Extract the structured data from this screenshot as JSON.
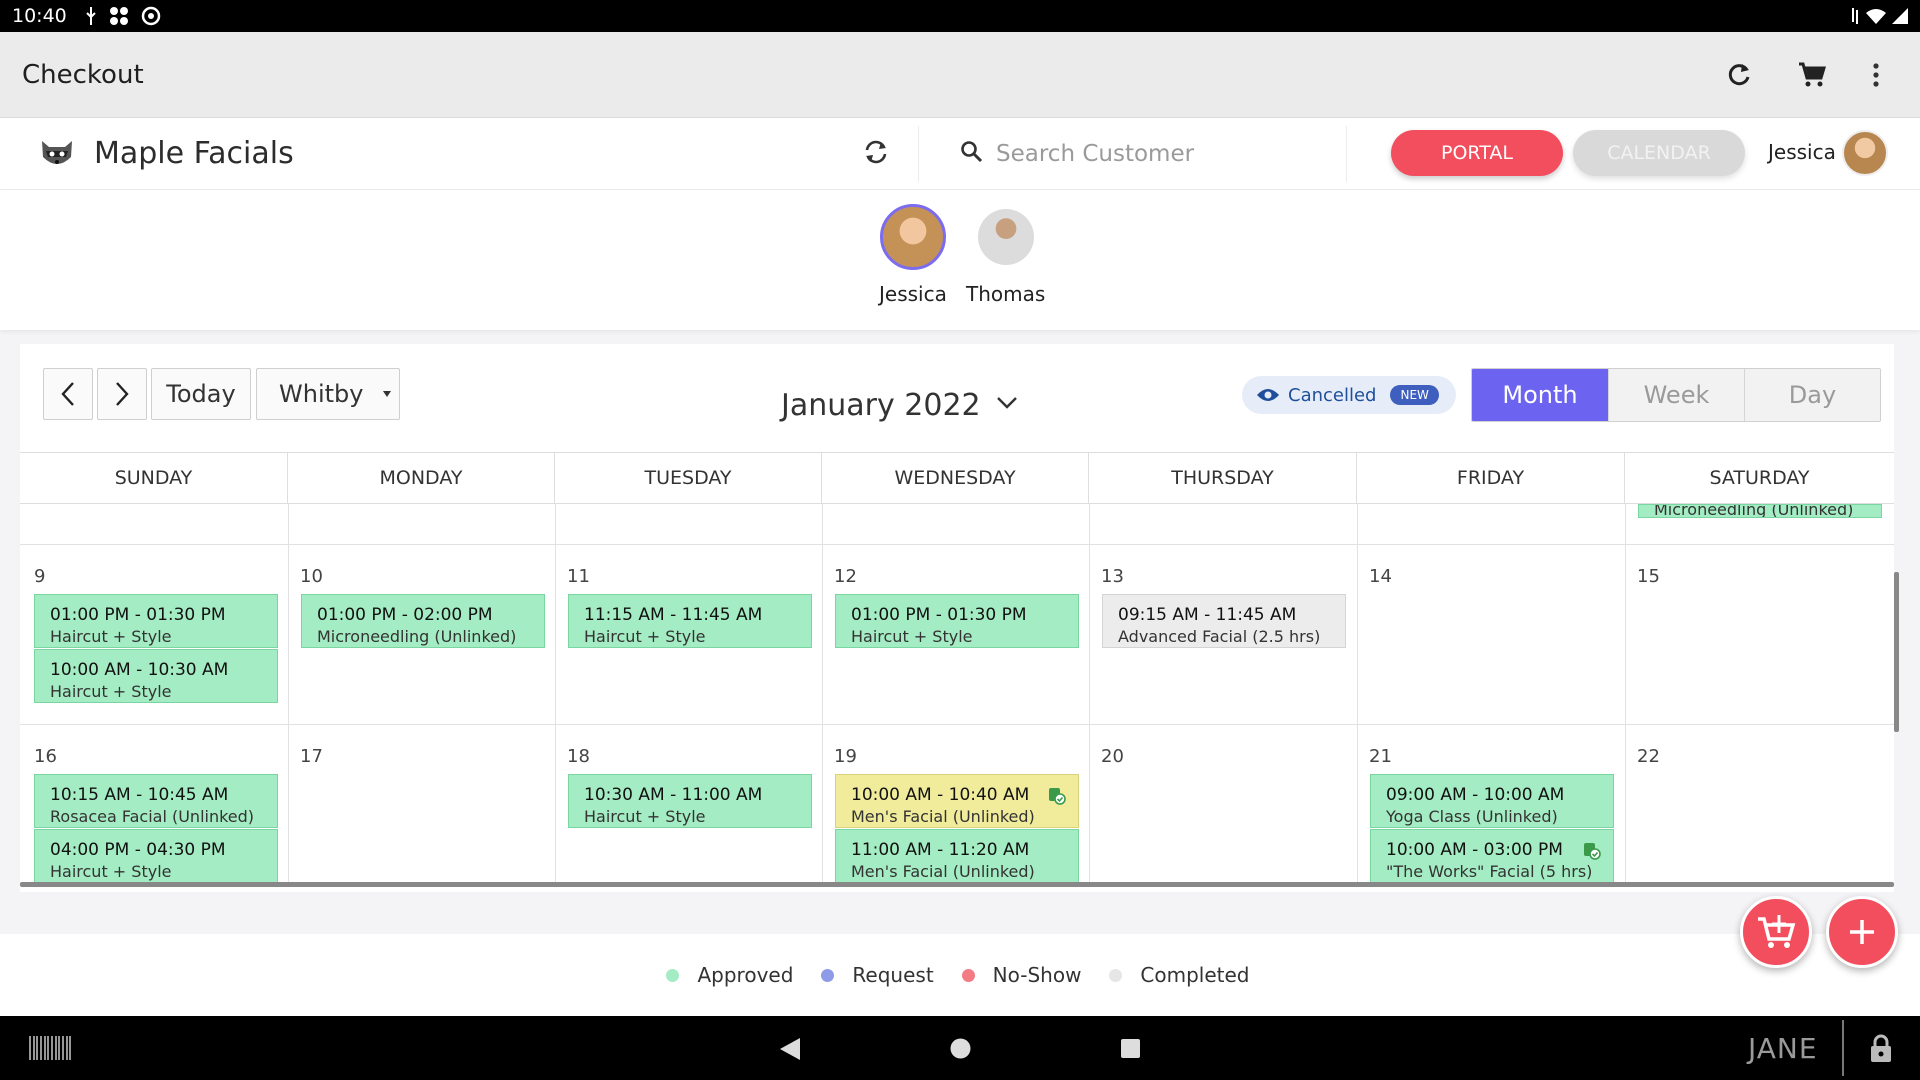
{
  "status_bar": {
    "time": "10:40"
  },
  "app_bar": {
    "title": "Checkout",
    "icons": [
      "refresh-icon",
      "cart-icon",
      "more-vert-icon"
    ]
  },
  "header": {
    "brand": "Maple Facials",
    "search_placeholder": "Search Customer",
    "portal_label": "PORTAL",
    "calendar_label": "CALENDAR",
    "user_name": "Jessica",
    "colors": {
      "portal": "#f24e5e",
      "calendar": "#d9d9d9"
    }
  },
  "staff": [
    {
      "name": "Jessica",
      "selected": true
    },
    {
      "name": "Thomas",
      "selected": false
    }
  ],
  "toolbar": {
    "today_label": "Today",
    "location": "Whitby",
    "month_label": "January 2022",
    "cancelled_label": "Cancelled",
    "new_badge": "NEW",
    "views": [
      "Month",
      "Week",
      "Day"
    ],
    "active_view": "Month"
  },
  "weekdays": [
    "SUNDAY",
    "MONDAY",
    "TUESDAY",
    "WEDNESDAY",
    "THURSDAY",
    "FRIDAY",
    "SATURDAY"
  ],
  "partial_event": {
    "service": "Microneedling (Unlinked)"
  },
  "weeks": [
    {
      "days": [
        {
          "num": "9",
          "events": [
            {
              "time": "01:00 PM - 01:30 PM",
              "service": "Haircut + Style",
              "status": "approved"
            },
            {
              "time": "10:00 AM - 10:30 AM",
              "service": "Haircut + Style",
              "status": "approved"
            }
          ]
        },
        {
          "num": "10",
          "events": [
            {
              "time": "01:00 PM - 02:00 PM",
              "service": "Microneedling (Unlinked)",
              "status": "approved"
            }
          ]
        },
        {
          "num": "11",
          "events": [
            {
              "time": "11:15 AM - 11:45 AM",
              "service": "Haircut + Style",
              "status": "approved"
            }
          ]
        },
        {
          "num": "12",
          "events": [
            {
              "time": "01:00 PM - 01:30 PM",
              "service": "Haircut + Style",
              "status": "approved"
            }
          ]
        },
        {
          "num": "13",
          "events": [
            {
              "time": "09:15 AM - 11:45 AM",
              "service": "Advanced Facial (2.5 hrs)",
              "status": "completed"
            }
          ]
        },
        {
          "num": "14",
          "events": []
        },
        {
          "num": "15",
          "events": []
        }
      ]
    },
    {
      "days": [
        {
          "num": "16",
          "events": [
            {
              "time": "10:15 AM - 10:45 AM",
              "service": "Rosacea Facial (Unlinked)",
              "status": "approved"
            },
            {
              "time": "04:00 PM - 04:30 PM",
              "service": "Haircut + Style",
              "status": "approved"
            }
          ]
        },
        {
          "num": "17",
          "events": []
        },
        {
          "num": "18",
          "events": [
            {
              "time": "10:30 AM - 11:00 AM",
              "service": "Haircut + Style",
              "status": "approved"
            }
          ]
        },
        {
          "num": "19",
          "events": [
            {
              "time": "10:00 AM - 10:40 AM",
              "service": "Men's Facial (Unlinked)",
              "status": "checked-in"
            },
            {
              "time": "11:00 AM - 11:20 AM",
              "service": "Men's Facial (Unlinked)",
              "status": "approved"
            }
          ]
        },
        {
          "num": "20",
          "events": []
        },
        {
          "num": "21",
          "events": [
            {
              "time": "09:00 AM - 10:00 AM",
              "service": "Yoga Class (Unlinked)",
              "status": "approved"
            },
            {
              "time": "10:00 AM - 03:00 PM",
              "service": "\"The Works\" Facial (5 hrs)",
              "status": "approved"
            }
          ]
        },
        {
          "num": "22",
          "events": []
        }
      ]
    }
  ],
  "legend": [
    {
      "label": "Approved",
      "color": "#a4ecc3"
    },
    {
      "label": "Request",
      "color": "#8e9be6"
    },
    {
      "label": "No-Show",
      "color": "#f37b84"
    },
    {
      "label": "Completed",
      "color": "#e6e6e6"
    }
  ],
  "nav_bar": {
    "device_label": "JANE"
  }
}
